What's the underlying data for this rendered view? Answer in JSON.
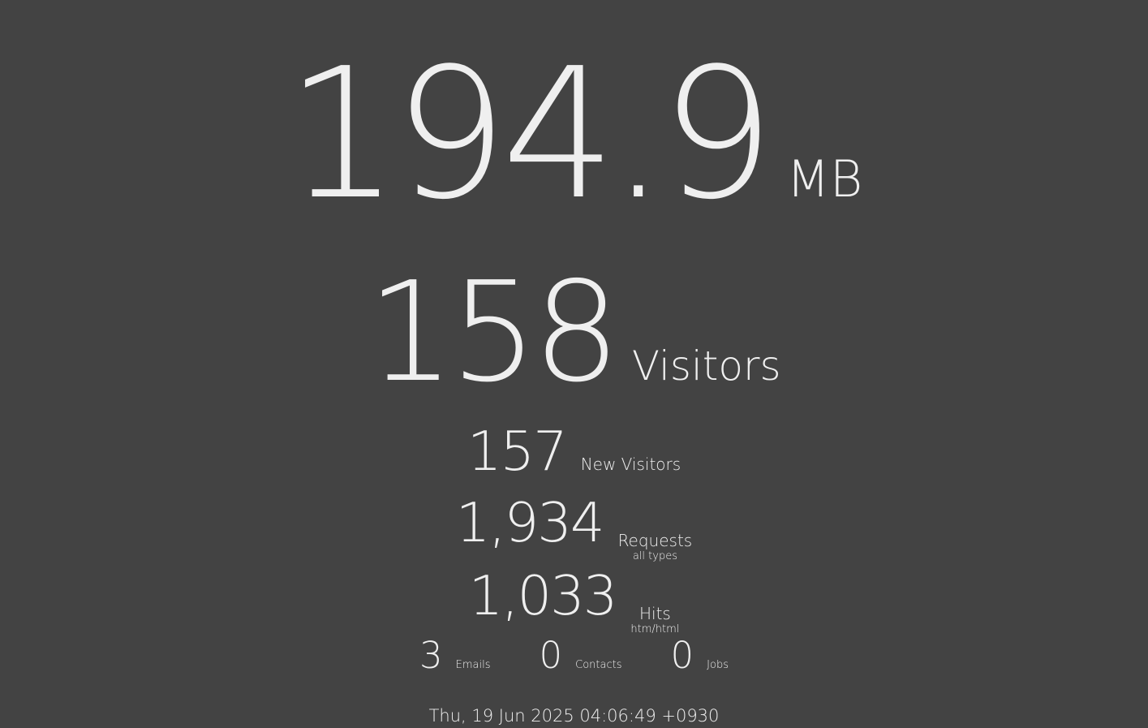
{
  "bandwidth": {
    "value": "194.9",
    "unit": "MB"
  },
  "visitors": {
    "value": "158",
    "label": "Visitors"
  },
  "new_visitors": {
    "value": "157",
    "label": "New Visitors"
  },
  "requests": {
    "value": "1,934",
    "label": "Requests",
    "sublabel": "all types"
  },
  "hits": {
    "value": "1,033",
    "label": "Hits",
    "sublabel": "htm/html"
  },
  "counts": [
    {
      "value": "3",
      "label": "Emails"
    },
    {
      "value": "0",
      "label": "Contacts"
    },
    {
      "value": "0",
      "label": "Jobs"
    }
  ],
  "timestamp": "Thu, 19 Jun 2025 04:06:49 +0930",
  "colors": {
    "background": "#434343",
    "text": "#efefef"
  }
}
